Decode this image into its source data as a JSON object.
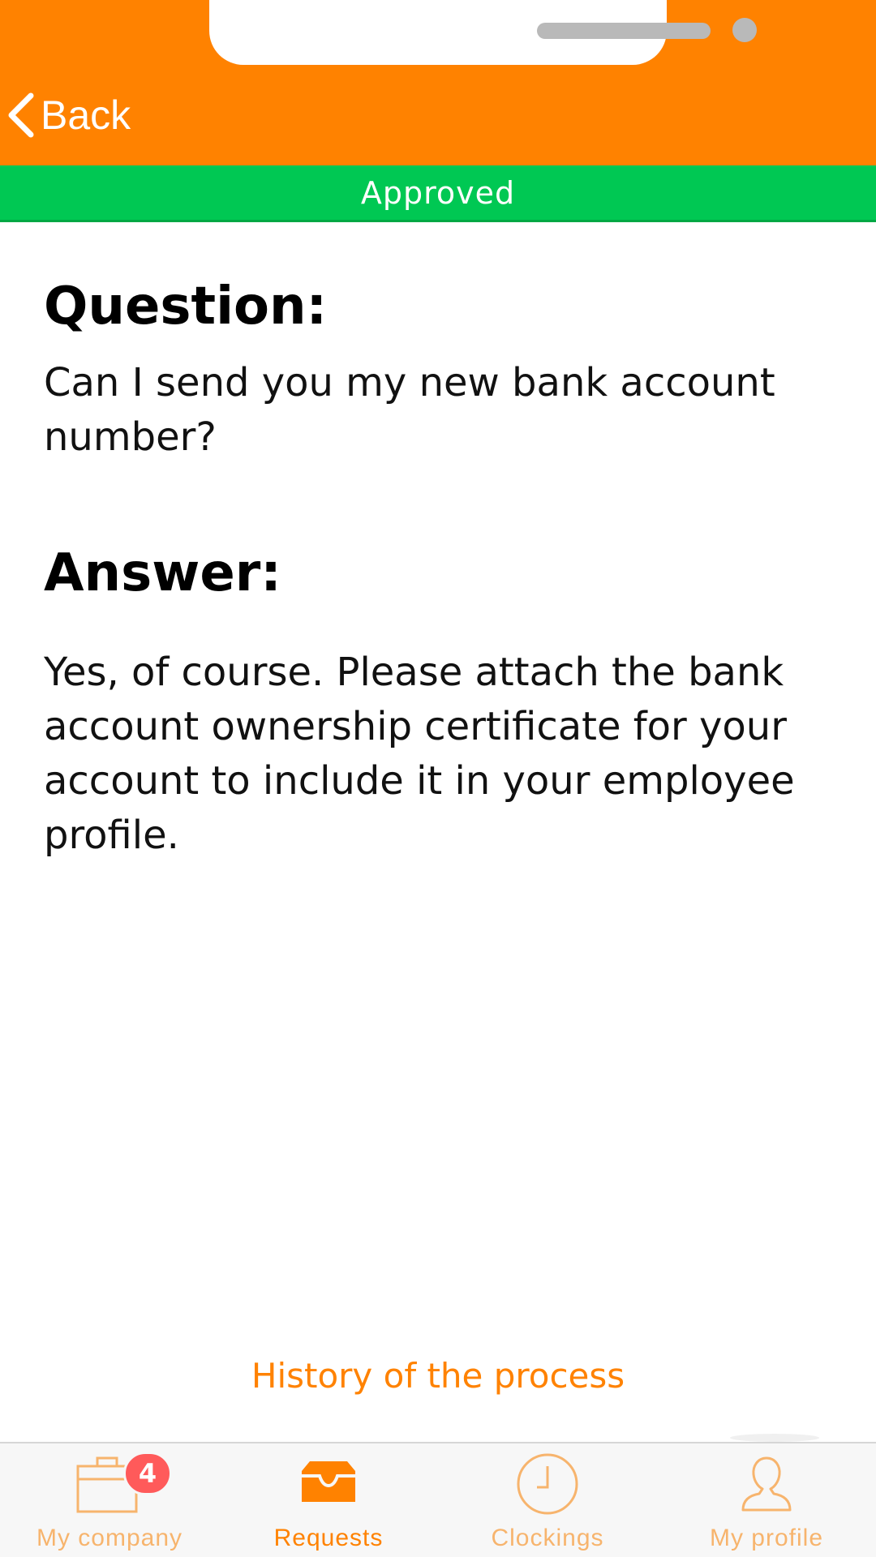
{
  "colors": {
    "accent": "#ff8200",
    "success": "#00c853",
    "badge": "#ff5a5a"
  },
  "header": {
    "back_label": "Back",
    "back_icon": "chevron-left-icon"
  },
  "status": {
    "label": "Approved"
  },
  "content": {
    "question_heading": "Question:",
    "question_text": "Can I send you my new bank account number?",
    "answer_heading": "Answer:",
    "answer_text": "Yes, of course. Please attach the bank account ownership certificate for your account to include it in your employee profile."
  },
  "history_link": "History of the process",
  "tabs": [
    {
      "label": "My company",
      "icon": "briefcase-icon",
      "badge": "4",
      "active": false
    },
    {
      "label": "Requests",
      "icon": "inbox-tray-icon",
      "active": true
    },
    {
      "label": "Clockings",
      "icon": "clock-icon",
      "active": false
    },
    {
      "label": "My profile",
      "icon": "user-icon",
      "active": false
    }
  ]
}
